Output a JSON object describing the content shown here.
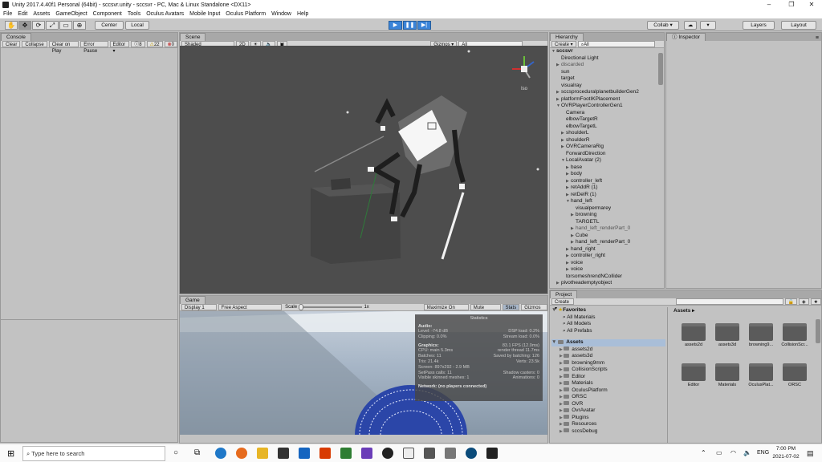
{
  "window": {
    "title": "Unity 2017.4.40f1 Personal (64bit) - sccsvr.unity - sccsvr - PC, Mac & Linux Standalone <DX11>",
    "min": "–",
    "max": "❐",
    "close": "✕"
  },
  "menu": [
    "File",
    "Edit",
    "Assets",
    "GameObject",
    "Component",
    "Tools",
    "Oculus Avatars",
    "Mobile Input",
    "Oculus Platform",
    "Window",
    "Help"
  ],
  "toolbar": {
    "center": "Center",
    "local": "Local",
    "collab": "Collab ▾",
    "layers": "Layers",
    "layout": "Layout"
  },
  "console": {
    "tab": "Console",
    "buttons": [
      "Clear",
      "Collapse",
      "Clear on Play",
      "Error Pause",
      "Editor ▾"
    ],
    "counts": [
      "8",
      "22",
      "0"
    ]
  },
  "scene": {
    "tab": "Scene",
    "shading": "Shaded",
    "mode": "2D",
    "gizmos": "Gizmos ▾",
    "search": "All",
    "persp": "Iso"
  },
  "game": {
    "tab": "Game",
    "display": "Display 1",
    "aspect": "Free Aspect",
    "scale_label": "Scale",
    "scale_value": "1x",
    "maximize": "Maximize On Play",
    "mute": "Mute Audio",
    "stats": "Stats",
    "gizmos": "Gizmos ▾"
  },
  "stats": {
    "title": "Statistics",
    "audio_heading": "Audio:",
    "audio": [
      [
        "Level: -74.8 dB",
        "DSP load: 0.2%"
      ],
      [
        "Clipping: 0.0%",
        "Stream load: 0.0%"
      ]
    ],
    "graphics_heading": "Graphics:",
    "fps": "83.1 FPS (12.0ms)",
    "graphics": [
      [
        "CPU: main 5.3ms",
        "render thread 11.7ms"
      ],
      [
        "Batches: 11",
        "Saved by batching: 126"
      ],
      [
        "Tris: 21.4k",
        "Verts: 23.5k"
      ],
      [
        "Screen: 897x292 - 2.9 MB",
        ""
      ],
      [
        "SetPass calls: 11",
        "Shadow casters: 0"
      ],
      [
        "Visible skinned meshes: 1",
        "Animations: 0"
      ]
    ],
    "network": "Network: (no players connected)"
  },
  "hierarchy": {
    "tab": "Hierarchy",
    "create": "Create ▾",
    "search": "All",
    "items": [
      {
        "t": "sccsvr",
        "a": "▼",
        "d": 0,
        "b": true
      },
      {
        "t": "Directional Light",
        "a": "",
        "d": 1
      },
      {
        "t": "discarded",
        "a": "▶",
        "d": 1,
        "dim": true
      },
      {
        "t": "sun",
        "a": "",
        "d": 1
      },
      {
        "t": "target",
        "a": "",
        "d": 1
      },
      {
        "t": "visualray",
        "a": "",
        "d": 1
      },
      {
        "t": "sccsproceduralplanetbuilderGen2",
        "a": "▶",
        "d": 1
      },
      {
        "t": "platformFootIKPlacement",
        "a": "▶",
        "d": 1
      },
      {
        "t": "OVRPlayerControllerGen1",
        "a": "▼",
        "d": 1
      },
      {
        "t": "Camera",
        "a": "",
        "d": 2
      },
      {
        "t": "elbowTargetR",
        "a": "",
        "d": 2
      },
      {
        "t": "elbowTargetL",
        "a": "",
        "d": 2
      },
      {
        "t": "shoulderL",
        "a": "▶",
        "d": 2
      },
      {
        "t": "shoulderR",
        "a": "▶",
        "d": 2
      },
      {
        "t": "OVRCameraRig",
        "a": "▶",
        "d": 2
      },
      {
        "t": "ForwardDirection",
        "a": "",
        "d": 2
      },
      {
        "t": "LocalAvatar (2)",
        "a": "▼",
        "d": 2
      },
      {
        "t": "base",
        "a": "▶",
        "d": 3
      },
      {
        "t": "body",
        "a": "▶",
        "d": 3
      },
      {
        "t": "controller_left",
        "a": "▶",
        "d": 3
      },
      {
        "t": "retAddR (1)",
        "a": "▶",
        "d": 3
      },
      {
        "t": "retDelR (1)",
        "a": "▶",
        "d": 3
      },
      {
        "t": "hand_left",
        "a": "▼",
        "d": 3
      },
      {
        "t": "visualpermarey",
        "a": "",
        "d": 4
      },
      {
        "t": "browning",
        "a": "▶",
        "d": 4
      },
      {
        "t": "TARGETL",
        "a": "",
        "d": 4
      },
      {
        "t": "hand_left_renderPart_0",
        "a": "▶",
        "d": 4,
        "dim": true
      },
      {
        "t": "Cube",
        "a": "▶",
        "d": 4
      },
      {
        "t": "hand_left_renderPart_0",
        "a": "▶",
        "d": 4
      },
      {
        "t": "hand_right",
        "a": "▶",
        "d": 3
      },
      {
        "t": "controller_right",
        "a": "▶",
        "d": 3
      },
      {
        "t": "voice",
        "a": "▶",
        "d": 3
      },
      {
        "t": "voice",
        "a": "▶",
        "d": 3
      },
      {
        "t": "torsomeshrendNCollider",
        "a": "",
        "d": 2
      },
      {
        "t": "pivotheademptyobject",
        "a": "▶",
        "d": 1
      }
    ]
  },
  "inspector": {
    "tab": "Inspector"
  },
  "project": {
    "tab": "Project",
    "create": "Create ▾",
    "favorites_label": "Favorites",
    "favorites": [
      "All Materials",
      "All Models",
      "All Prefabs"
    ],
    "assets_label": "Assets",
    "folders": [
      "assets2d",
      "assets3d",
      "browning9mm",
      "CollisionScripts",
      "Editor",
      "Materials",
      "OculusPlatform",
      "ORSC",
      "OVR",
      "OvrAvatar",
      "Plugins",
      "Resources",
      "sccsDebug"
    ],
    "breadcrumb": "Assets ▸",
    "grid": [
      "assets2d",
      "assets3d",
      "browning9...",
      "CollisionScr...",
      "Editor",
      "Materials",
      "OculusPlat...",
      "ORSC"
    ]
  },
  "taskbar": {
    "search_placeholder": "Type here to search",
    "lang": "ENG",
    "time": "7:00 PM",
    "date": "2021-07-02"
  }
}
